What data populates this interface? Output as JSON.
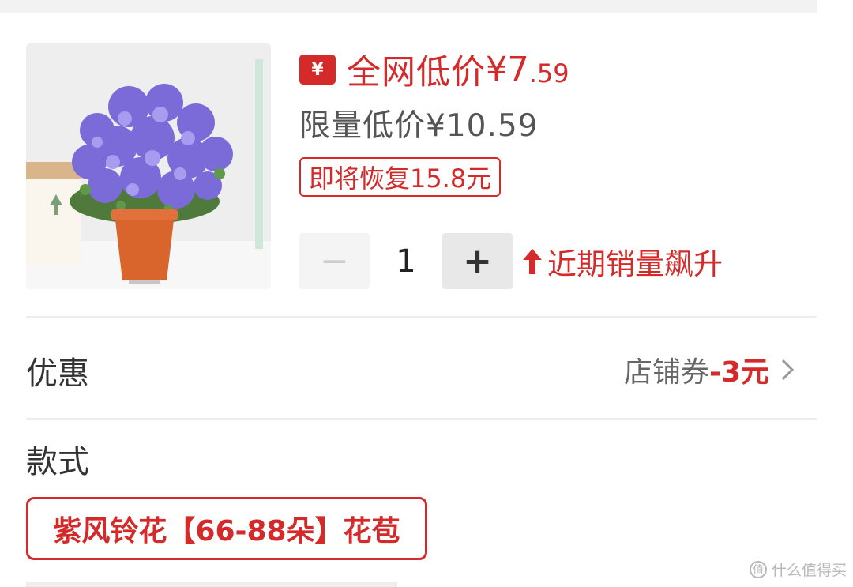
{
  "product": {
    "image_alt_icon": "product-photo-purple-bellflower",
    "price_badge_symbol": "¥",
    "price_label": "全网低价",
    "price_currency": "¥",
    "price_integer": "7",
    "price_decimal": ".59",
    "limited_price": "限量低价¥10.59",
    "restore_tag": "即将恢复15.8元",
    "quantity": "1",
    "minus_symbol": "−",
    "plus_symbol": "+",
    "trend_text": "近期销量飙升"
  },
  "discount": {
    "label": "优惠",
    "coupon_prefix": "店铺券",
    "coupon_amount": "-3元"
  },
  "style": {
    "label": "款式",
    "selected_option": "紫风铃花【66-88朵】花苞"
  },
  "watermark": {
    "logo_char": "值",
    "text": "什么值得买"
  },
  "colors": {
    "accent_red": "#d42a2a",
    "divider": "#ededed",
    "stepper_bg": "#e8e8e8"
  }
}
